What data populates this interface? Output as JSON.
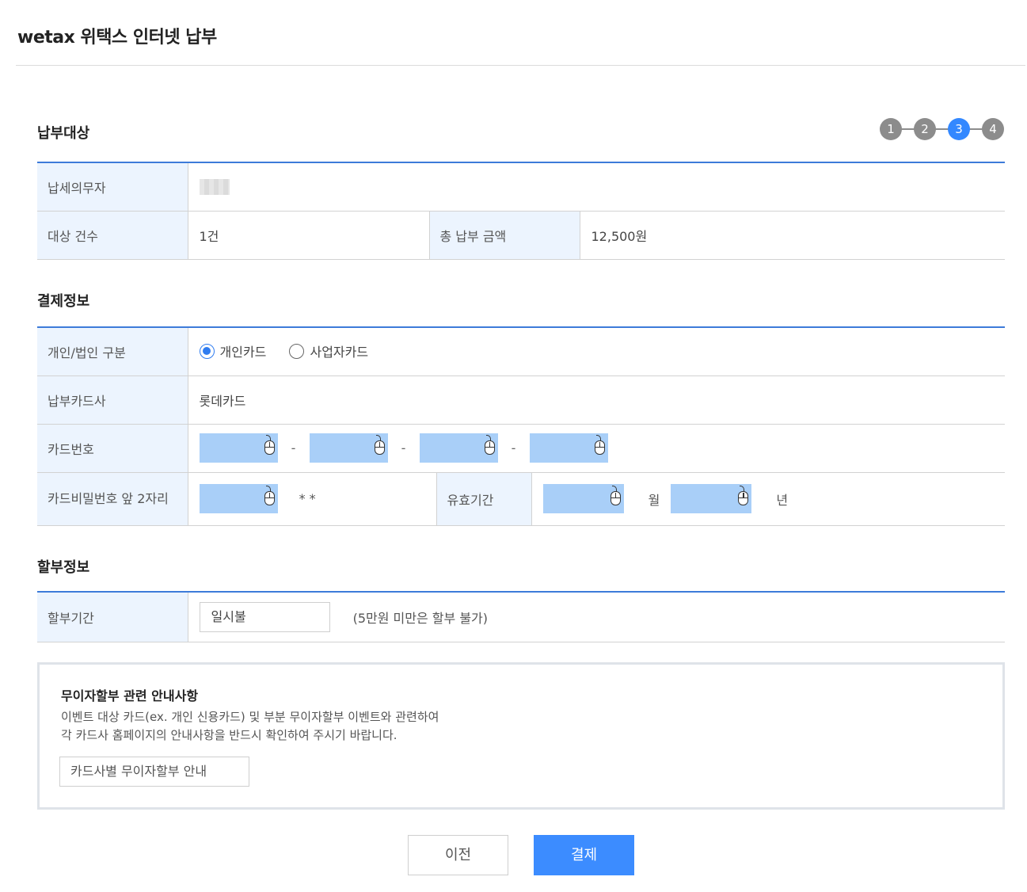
{
  "header": {
    "title": "wetax 위택스 인터넷 납부"
  },
  "steps": {
    "items": [
      "1",
      "2",
      "3",
      "4"
    ],
    "active_index": 2
  },
  "target": {
    "section_title": "납부대상",
    "taxpayer_label": "납세의무자",
    "count_label": "대상 건수",
    "count_value": "1건",
    "total_label": "총 납부 금액",
    "total_value": "12,500원"
  },
  "payment": {
    "section_title": "결제정보",
    "type_label": "개인/법인 구분",
    "options": [
      {
        "label": "개인카드",
        "checked": true
      },
      {
        "label": "사업자카드",
        "checked": false
      }
    ],
    "card_company_label": "납부카드사",
    "card_company_value": "롯데카드",
    "card_number_label": "카드번호",
    "card_number_separator": "-",
    "pin_label": "카드비밀번호 앞 2자리",
    "pin_suffix": "* *",
    "expiry_label": "유효기간",
    "month_unit": "월",
    "year_unit": "년",
    "secure_input_icon": "mouse-icon",
    "secure_input_color": "#a9cff8"
  },
  "installment": {
    "section_title": "할부정보",
    "period_label": "할부기간",
    "period_value": "일시불",
    "note": "(5만원 미만은 할부 불가)"
  },
  "guide": {
    "title": "무이자할부 관련 안내사항",
    "line1": "이벤트 대상 카드(ex. 개인 신용카드) 및 부분 무이자할부 이벤트와 관련하여",
    "line2": "각 카드사 홈페이지의 안내사항을 반드시 확인하여 주시기 바랍니다.",
    "button": "카드사별 무이자할부 안내"
  },
  "actions": {
    "prev": "이전",
    "pay": "결제"
  },
  "colors": {
    "accent": "#3c8cff",
    "table_border": "#3d7bd9",
    "header_cell": "#ecf4fe"
  }
}
